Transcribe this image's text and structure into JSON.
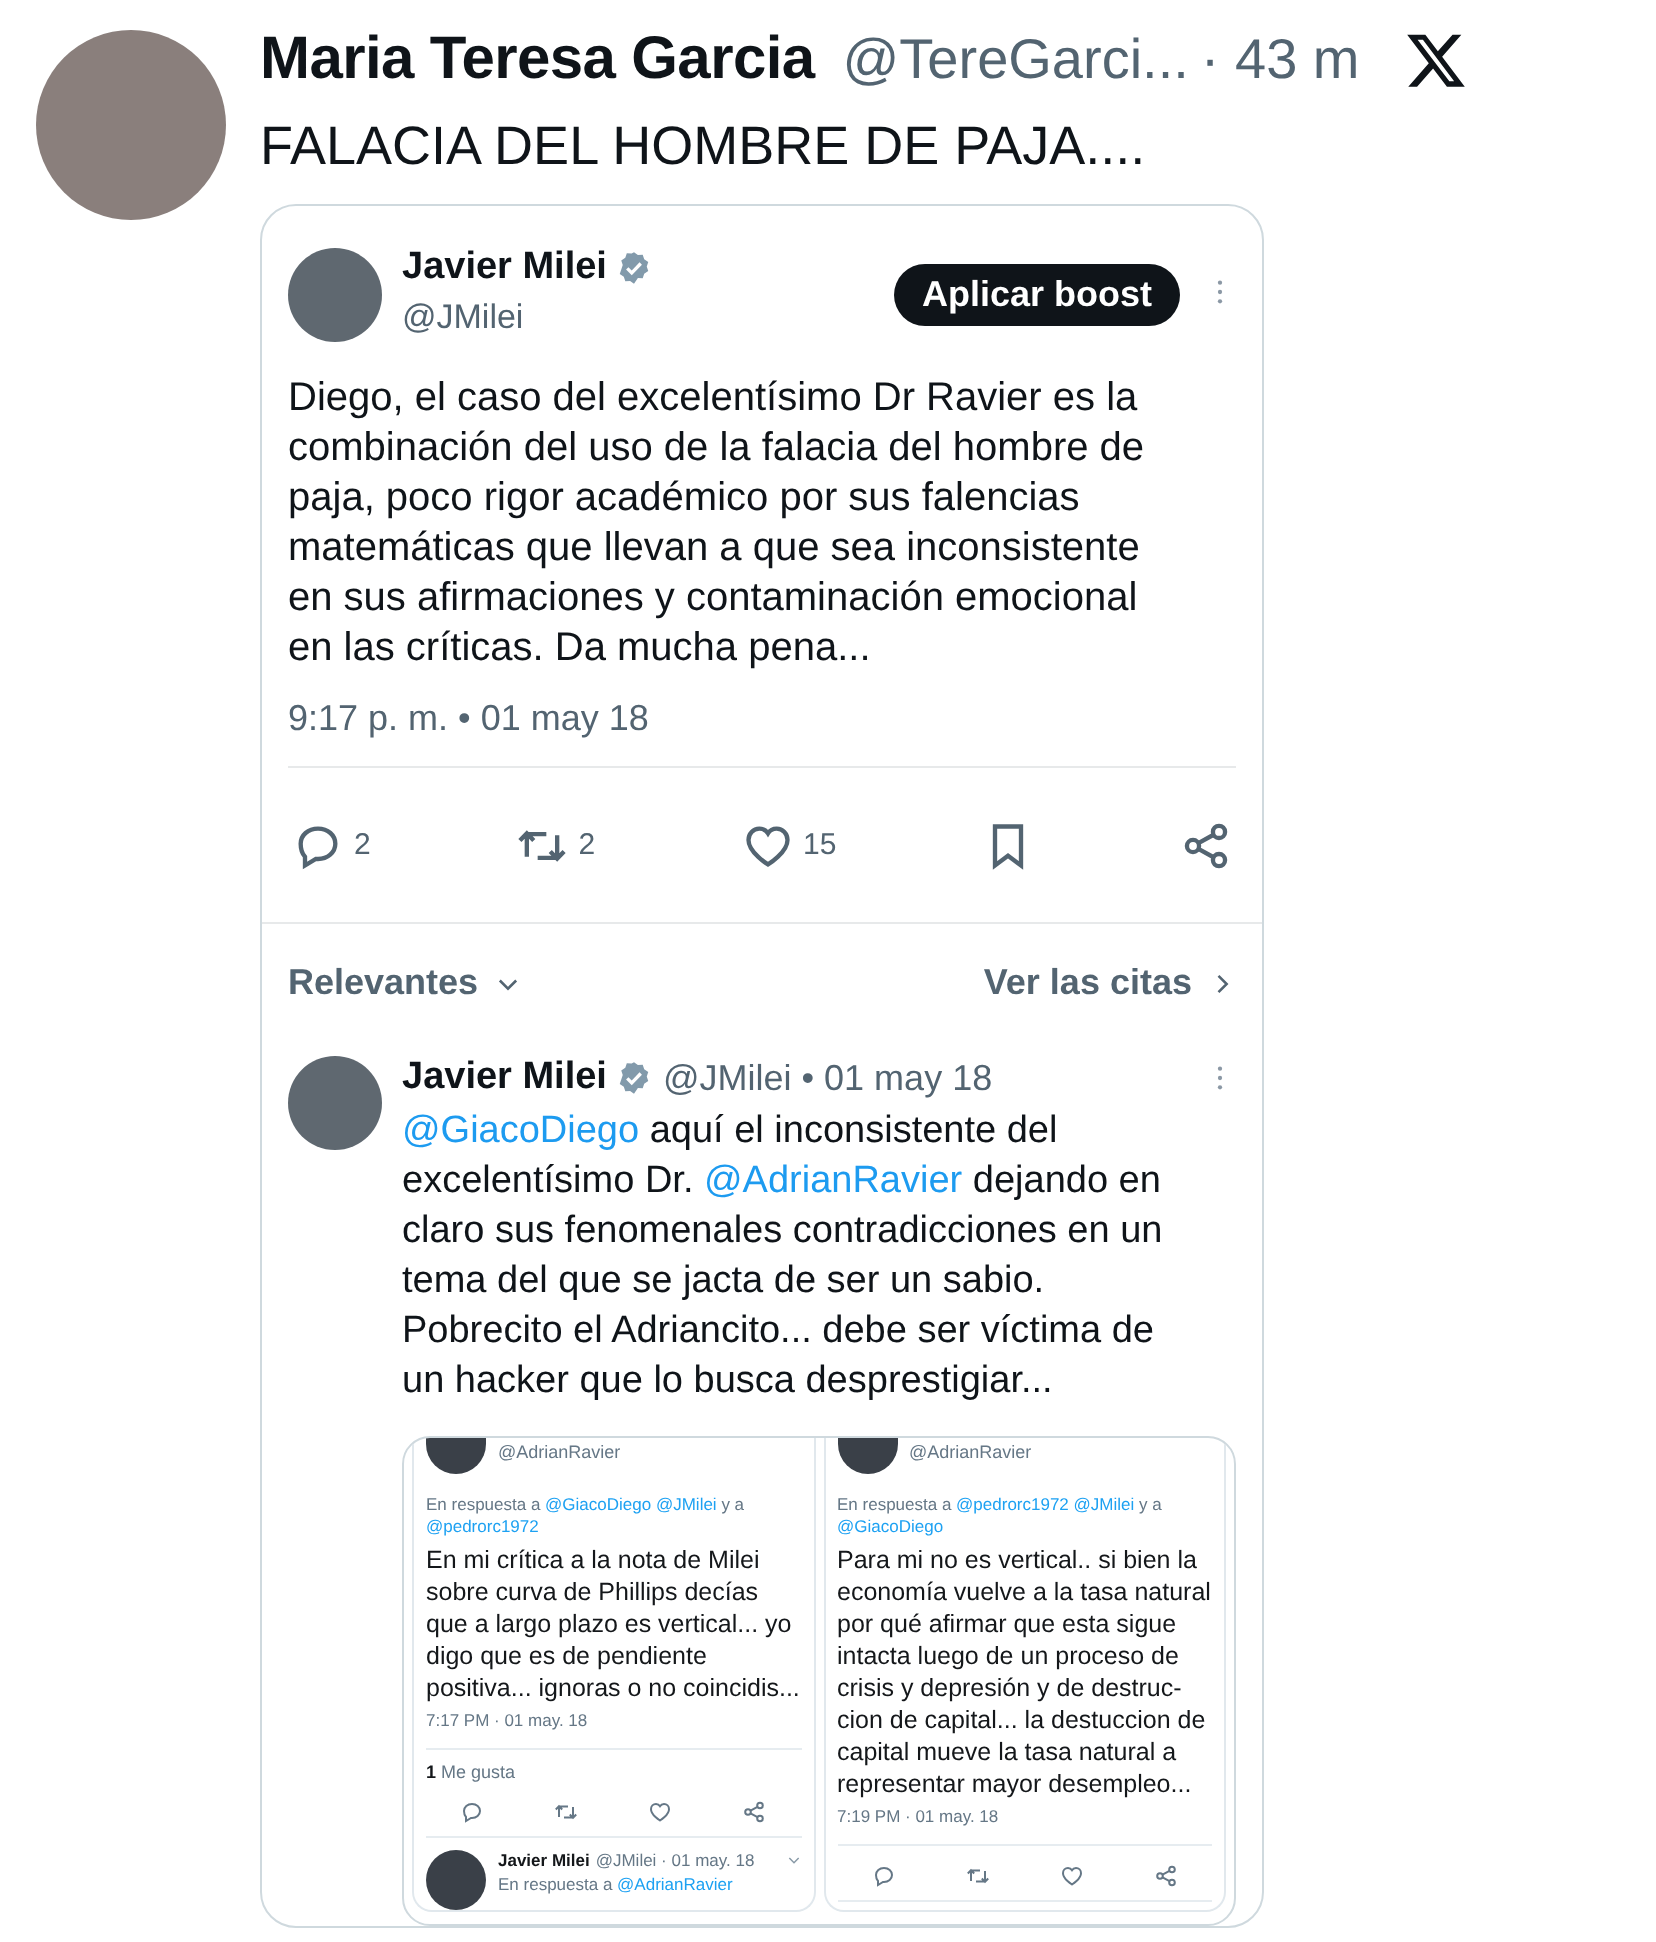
{
  "post": {
    "author_name": "Maria Teresa Garcia",
    "handle": "@TereGarci...",
    "time": "· 43 m",
    "text": "FALACIA DEL HOMBRE DE PAJA...."
  },
  "quoted": {
    "author_name": "Javier Milei",
    "handle": "@JMilei",
    "button": "Aplicar boost",
    "text": "Diego, el caso del excelentísimo Dr Ravier es la combinación del uso de la falacia del hombre de paja, poco rigor académico por sus falencias matemáticas que llevan a que sea inconsistente en sus afirmaciones y contaminación emocional en las críticas. Da mucha pena...",
    "timestamp": "9:17 p. m. • 01 may 18",
    "actions": [
      {
        "kind": "reply",
        "count": "2"
      },
      {
        "kind": "repost",
        "count": "2"
      },
      {
        "kind": "like",
        "count": "15"
      },
      {
        "kind": "bookmark"
      },
      {
        "kind": "share"
      }
    ]
  },
  "replies_bar": {
    "sort_label": "Relevantes",
    "quotes_link": "Ver las citas"
  },
  "reply": {
    "author_name": "Javier Milei",
    "handle": "@JMilei",
    "date": "• 01 may 18",
    "segments": [
      {
        "kind": "mention",
        "text": "@GiacoDiego"
      },
      {
        "kind": "text",
        "text": " aquí el inconsistente del excelentísimo Dr. "
      },
      {
        "kind": "mention",
        "text": "@AdrianRavier"
      },
      {
        "kind": "text",
        "text": " dejando en claro sus fenomenales contradicciones en un tema del que se jacta de ser un sabio. Pobrecito el Adriancito... debe ser víctima de un hacker que lo busca desprestigiar..."
      }
    ],
    "images": [
      {
        "handle": "@AdrianRavier",
        "reply_to": [
          {
            "kind": "text",
            "text": "En respuesta a "
          },
          {
            "kind": "mention",
            "text": "@GiacoDiego"
          },
          {
            "kind": "mention",
            "text": "@JMilei"
          },
          {
            "kind": "text",
            "text": " y a "
          },
          {
            "kind": "mention",
            "text": "@pedrorc1972"
          }
        ],
        "text": "En mi crítica a la nota de Milei sobre curva de Phillips decías que a largo plazo es vertical... yo digo que es de pendiente positiva... ignoras o no coincidis...",
        "timestamp": "7:17 PM · 01 may. 18",
        "likes": "**1** Me gusta",
        "next": {
          "name": "Javier Milei",
          "meta": "@JMilei · 01 may. 18",
          "reply_to": [
            {
              "kind": "text",
              "text": "En respuesta a "
            },
            {
              "kind": "mention",
              "text": "@AdrianRavier"
            }
          ]
        }
      },
      {
        "handle": "@AdrianRavier",
        "reply_to": [
          {
            "kind": "text",
            "text": "En respuesta a "
          },
          {
            "kind": "mention",
            "text": "@pedrorc1972"
          },
          {
            "kind": "mention",
            "text": "@JMilei"
          },
          {
            "kind": "text",
            "text": " y a "
          },
          {
            "kind": "mention",
            "text": "@GiacoDiego"
          }
        ],
        "text": "Para mi no es vertical.. si bien la economía vuelve a la tasa natural por qué afirmar que esta sigue intacta luego de un proceso de crisis y depresión y de destruc-cion de capital... la destuccion de capital mueve la tasa natural a representar mayor desempleo...",
        "timestamp": "7:19 PM · 01 may. 18"
      }
    ]
  }
}
